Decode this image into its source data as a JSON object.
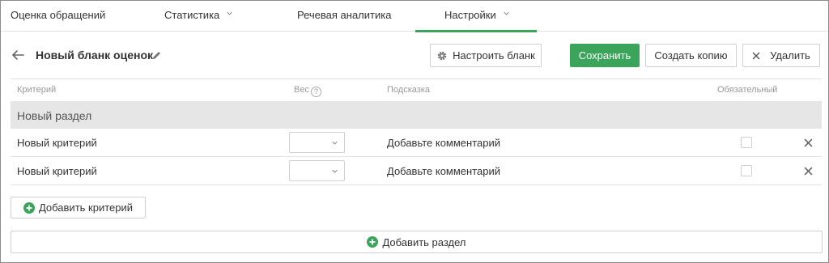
{
  "colors": {
    "accent": "#3aa55a",
    "section_bg": "#e6e6e6",
    "border": "#cfcfcf"
  },
  "nav": {
    "tabs": [
      {
        "label": "Оценка обращений",
        "dropdown": false,
        "active": false
      },
      {
        "label": "Статистика",
        "dropdown": true,
        "active": false
      },
      {
        "label": "Речевая аналитика",
        "dropdown": false,
        "active": false
      },
      {
        "label": "Настройки",
        "dropdown": true,
        "active": true
      }
    ]
  },
  "header": {
    "title": "Новый бланк оценок",
    "setup_label": "Настроить бланк",
    "save_label": "Сохранить",
    "copy_label": "Создать копию",
    "delete_label": "Удалить"
  },
  "table": {
    "columns": {
      "criterion": "Критерий",
      "weight": "Вес",
      "weight_help": "?",
      "hint": "Подсказка",
      "required": "Обязательный"
    },
    "section": {
      "title": "Новый раздел",
      "rows": [
        {
          "name": "Новый критерий",
          "weight": "",
          "hint": "Добавьте комментарий",
          "required": false
        },
        {
          "name": "Новый критерий",
          "weight": "",
          "hint": "Добавьте комментарий",
          "required": false
        }
      ]
    }
  },
  "actions": {
    "add_criterion": "Добавить критерий",
    "add_section": "Добавить раздел"
  }
}
